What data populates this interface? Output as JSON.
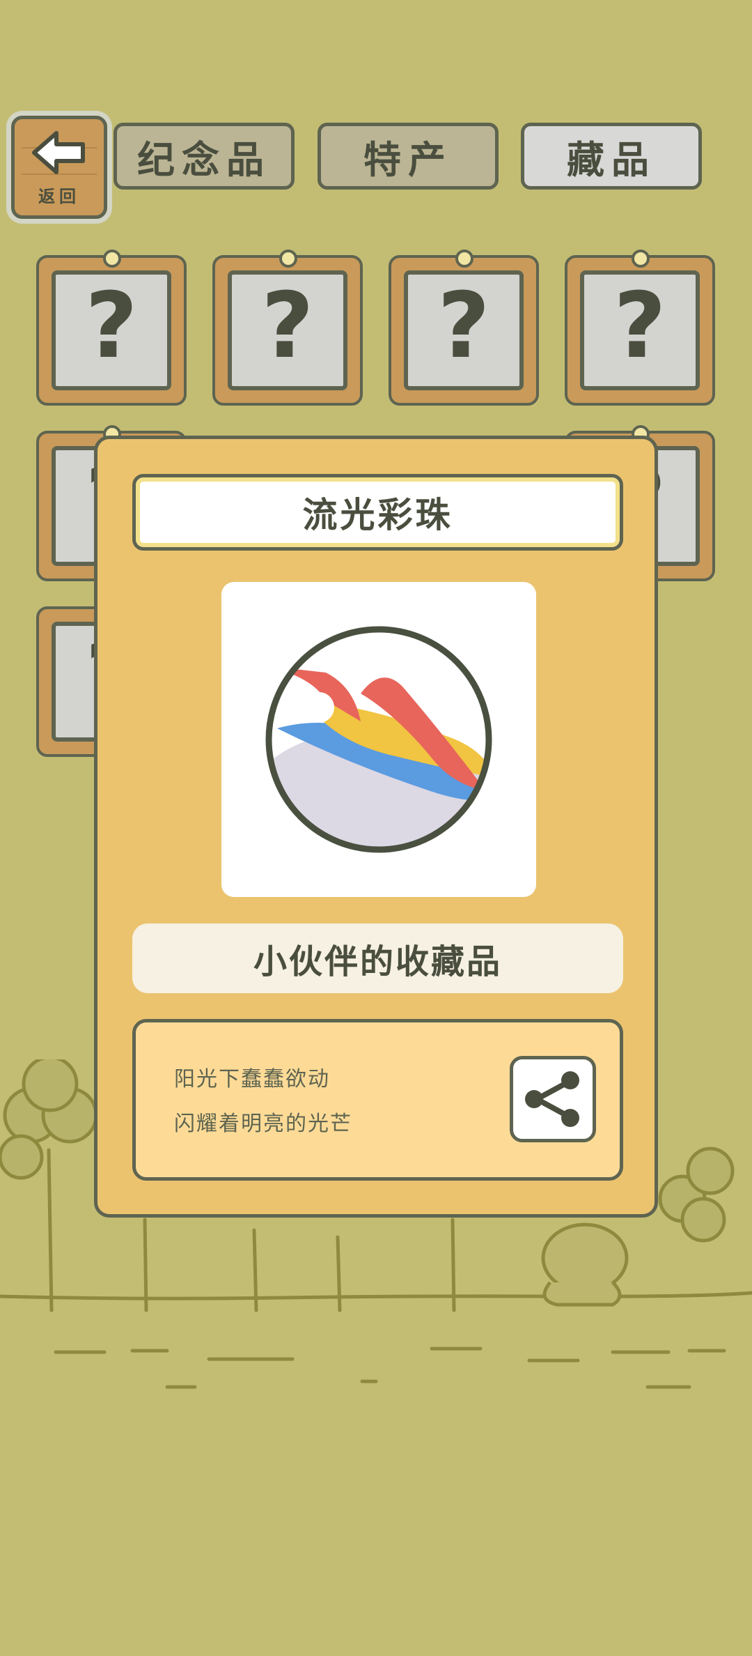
{
  "colors": {
    "background": "#c3bd74",
    "wood": "#c99a5a",
    "outline": "#5e6450",
    "modal": "#ebc36f",
    "desc_box": "#fddb97",
    "marble_red": "#e8655b",
    "marble_yellow": "#f1c441",
    "marble_blue": "#5b9be0"
  },
  "top_bar": {
    "back_label": "返回",
    "back_icon": "arrow-left-icon",
    "tabs": [
      {
        "label": "纪念品",
        "active": false
      },
      {
        "label": "特产",
        "active": false
      },
      {
        "label": "藏品",
        "active": true
      }
    ]
  },
  "grid": {
    "placeholder_glyph": "?",
    "visible_cards": 4
  },
  "modal": {
    "item_name": "流光彩珠",
    "item_icon": "marble-icon",
    "category": "小伙伴的收藏品",
    "description_lines": [
      "阳光下蠢蠢欲动",
      "闪耀着明亮的光芒"
    ],
    "share_icon": "share-icon"
  }
}
